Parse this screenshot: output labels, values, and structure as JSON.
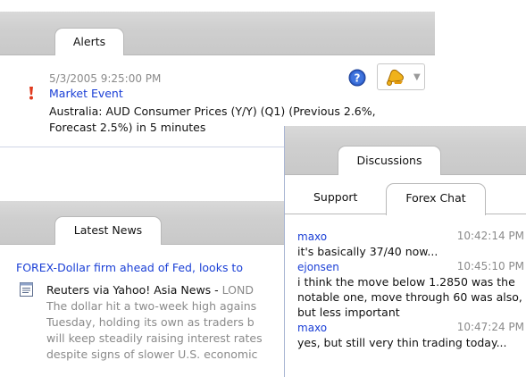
{
  "alerts": {
    "tab_label": "Alerts",
    "timestamp": "5/3/2005 9:25:00 PM",
    "event_title": "Market Event",
    "event_text": "Australia: AUD Consumer Prices (Y/Y) (Q1) (Previous 2.6%, Forecast 2.5%) in 5 minutes",
    "icons": {
      "priority": "exclamation-icon",
      "help": "help-icon",
      "alert_button": "bell-icon"
    }
  },
  "news": {
    "tab_label": "Latest News",
    "headline": "FOREX-Dollar firm ahead of Fed, looks to",
    "source": "Reuters via Yahoo! Asia News - ",
    "body_lines": [
      "LOND",
      "The dollar hit a two-week high agains",
      "Tuesday, holding its own as traders b",
      "will keep steadily raising interest rates",
      "despite signs of slower U.S. economic"
    ]
  },
  "discussions": {
    "tab_label": "Discussions",
    "subtabs": {
      "support": "Support",
      "forex_chat": "Forex Chat"
    },
    "messages": [
      {
        "user": "maxo",
        "time": "10:42:14 PM",
        "text": "it's basically 37/40 now..."
      },
      {
        "user": "ejonsen",
        "time": "10:45:10 PM",
        "text": "i think the move below 1.2850 was the notable one, move through 60 was also, but less important"
      },
      {
        "user": "maxo",
        "time": "10:47:24 PM",
        "text": "yes, but still very thin trading today..."
      }
    ]
  },
  "colors": {
    "link_blue": "#1a3fd6",
    "muted_gray": "#8a8a8a",
    "tab_bar_gray": "#cfcfcf"
  }
}
